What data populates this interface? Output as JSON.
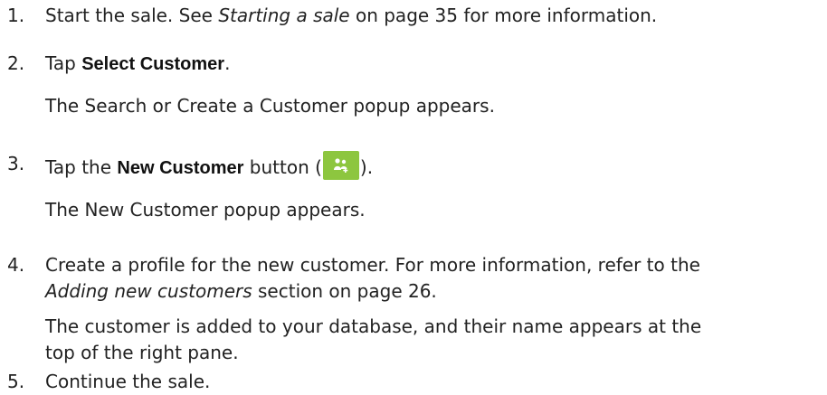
{
  "steps": [
    {
      "number": "1.",
      "before": "Start the sale. See ",
      "ref": "Starting a sale",
      "after": " on page 35 for more information."
    },
    {
      "number": "2.",
      "before": "Tap ",
      "ui": "Select Customer",
      "after": ".",
      "note": "The Search or Create a Customer popup appears."
    },
    {
      "number": "3.",
      "before": "Tap the ",
      "ui": "New Customer",
      "middle": " button (",
      "after": ").",
      "icon": "new-customer-icon",
      "icon_color": "#8dc63f",
      "note": "The New Customer popup appears."
    },
    {
      "number": "4.",
      "line1": "Create a profile for the new customer. For more information, refer to the",
      "ref": "Adding new customers",
      "line2_after": " section on page 26.",
      "note_line1": "The customer is added to your database, and their name appears at the",
      "note_line2": "top of the right pane."
    },
    {
      "number": "5.",
      "text": "Continue the sale."
    }
  ]
}
